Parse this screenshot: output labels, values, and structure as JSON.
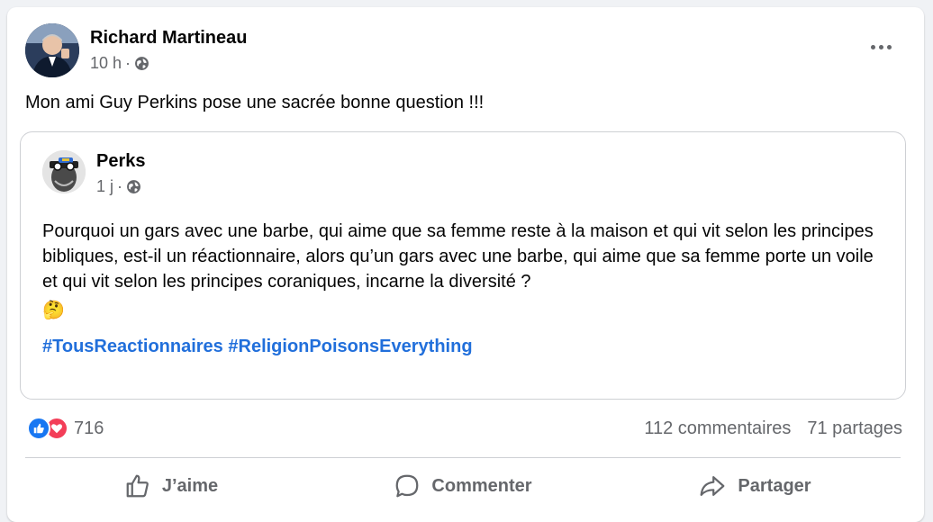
{
  "post": {
    "author": "Richard Martineau",
    "time": "10 h",
    "separator": "·",
    "text": "Mon ami Guy Perkins pose une sacrée bonne question !!!",
    "more_icon": "ellipsis-icon",
    "privacy_icon": "globe-icon"
  },
  "shared": {
    "author": "Perks",
    "time": "1 j",
    "separator": "·",
    "body": "Pourquoi un gars avec une barbe, qui aime que sa femme reste à la maison et qui vit selon les principes bibliques, est-il un réactionnaire, alors qu’un gars avec une barbe, qui aime que sa femme porte un voile et qui vit selon les principes coraniques, incarne la diversité ?",
    "emoji": "🤔",
    "hashtags": [
      "#TousReactionnaires",
      "#ReligionPoisonsEverything"
    ]
  },
  "stats": {
    "reaction_count": "716",
    "comments": "112 commentaires",
    "shares": "71 partages"
  },
  "actions": {
    "like": "J’aime",
    "comment": "Commenter",
    "share": "Partager"
  },
  "colors": {
    "link": "#216fdb",
    "like": "#1877f2",
    "love": "#f33e58",
    "secondary_text": "#65676b"
  }
}
